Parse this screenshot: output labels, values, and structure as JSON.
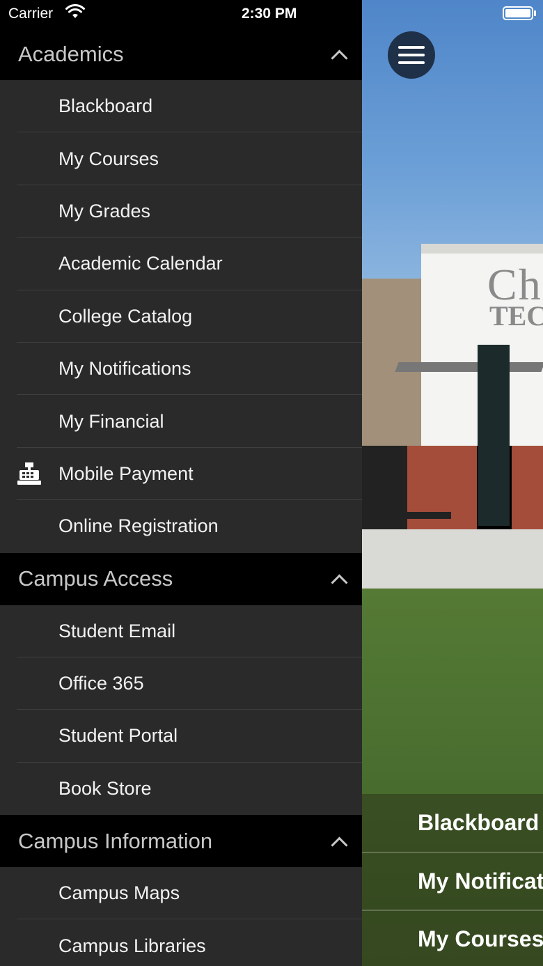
{
  "status_bar": {
    "carrier": "Carrier",
    "time": "2:30 PM"
  },
  "background": {
    "sign_line1": "Ch",
    "sign_line2": "TEC",
    "quick_links": [
      "Blackboard",
      "My Notifications",
      "My Courses"
    ]
  },
  "drawer": {
    "sections": [
      {
        "title": "Academics",
        "items": [
          "Blackboard",
          "My Courses",
          "My Grades",
          "Academic Calendar",
          "College Catalog",
          "My Notifications",
          "My Financial",
          "Mobile Payment",
          "Online Registration"
        ]
      },
      {
        "title": "Campus Access",
        "items": [
          "Student Email",
          "Office 365",
          "Student Portal",
          "Book Store"
        ]
      },
      {
        "title": "Campus Information",
        "items": [
          "Campus Maps",
          "Campus Libraries"
        ]
      }
    ]
  },
  "icons": {
    "menu": "hamburger-icon",
    "wifi": "wifi-icon",
    "battery": "battery-icon",
    "collapse": "chevron-up-icon",
    "mobile_payment": "cash-register-icon"
  },
  "colors": {
    "drawer_bg": "#2a2a2b",
    "header_bg": "#000000",
    "menu_button": "#1f3148"
  }
}
